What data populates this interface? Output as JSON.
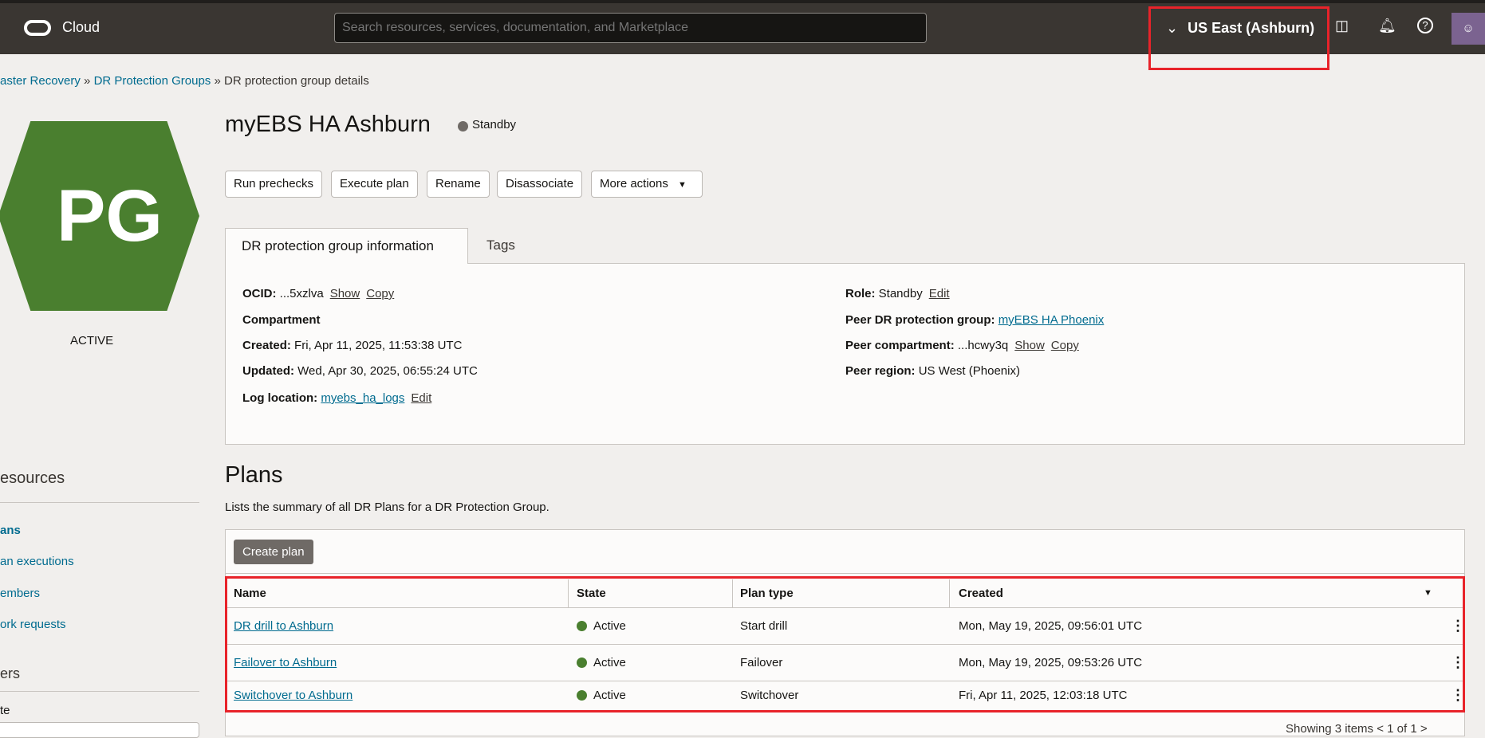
{
  "header": {
    "brand": "Cloud",
    "search_placeholder": "Search resources, services, documentation, and Marketplace",
    "region": "US East (Ashburn)",
    "icons": [
      "cloud-shell-icon",
      "bell-icon",
      "help-icon",
      "user-avatar-icon"
    ]
  },
  "breadcrumb": {
    "items": [
      "aster Recovery",
      "DR Protection Groups"
    ],
    "current": "DR protection group details"
  },
  "resource": {
    "badge": "PG",
    "state": "ACTIVE",
    "title": "myEBS HA Ashburn",
    "status": "Standby",
    "badge_color": "#4a7f2f"
  },
  "actions": [
    "Run prechecks",
    "Execute plan",
    "Rename",
    "Disassociate",
    "More actions"
  ],
  "tabs": [
    "DR protection group information",
    "Tags"
  ],
  "info": {
    "ocid_label": "OCID:",
    "ocid": "...5xzlva",
    "show": "Show",
    "copy": "Copy",
    "compartment_label": "Compartment",
    "created_label": "Created:",
    "created": "Fri, Apr 11, 2025, 11:53:38 UTC",
    "updated_label": "Updated:",
    "updated": "Wed, Apr 30, 2025, 06:55:24 UTC",
    "log_label": "Log location:",
    "log": "myebs_ha_logs",
    "edit": "Edit",
    "role_label": "Role:",
    "role": "Standby",
    "peer_label": "Peer DR protection group:",
    "peer": "myEBS HA Phoenix",
    "peer_comp_label": "Peer compartment:",
    "peer_comp": "...hcwy3q",
    "peer_region_label": "Peer region:",
    "peer_region": "US West (Phoenix)"
  },
  "sidebar": {
    "heading": "esources",
    "items": [
      "ans",
      "an executions",
      "embers",
      "ork requests"
    ],
    "filters": "ers",
    "filter_label": "te"
  },
  "plans": {
    "heading": "Plans",
    "description": "Lists the summary of all DR Plans for a DR Protection Group.",
    "create": "Create plan",
    "columns": [
      "Name",
      "State",
      "Plan type",
      "Created"
    ],
    "rows": [
      {
        "name": "DR drill to Ashburn",
        "state": "Active",
        "type": "Start drill",
        "created": "Mon, May 19, 2025, 09:56:01 UTC"
      },
      {
        "name": "Failover to Ashburn",
        "state": "Active",
        "type": "Failover",
        "created": "Mon, May 19, 2025, 09:53:26 UTC"
      },
      {
        "name": "Switchover to Ashburn",
        "state": "Active",
        "type": "Switchover",
        "created": "Fri, Apr 11, 2025, 12:03:18 UTC"
      }
    ],
    "footer": "Showing 3 items  < 1 of 1 >"
  }
}
